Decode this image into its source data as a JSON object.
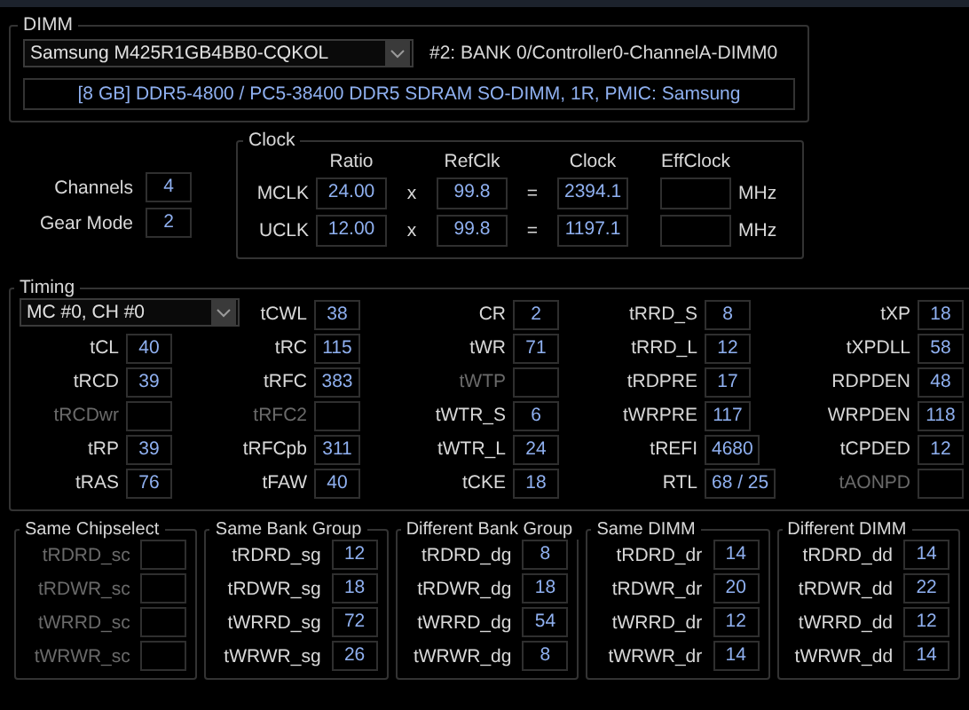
{
  "dimm": {
    "title": "DIMM",
    "module": "Samsung M425R1GB4BB0-CQKOL",
    "slot": "#2: BANK 0/Controller0-ChannelA-DIMM0",
    "description": "[8 GB] DDR5-4800 / PC5-38400 DDR5 SDRAM SO-DIMM, 1R, PMIC: Samsung"
  },
  "memory": [
    {
      "label": "Channels",
      "value": "4"
    },
    {
      "label": "Gear Mode",
      "value": "2"
    }
  ],
  "clock": {
    "title": "Clock",
    "columns": [
      "Ratio",
      "RefClk",
      "Clock",
      "EffClock"
    ],
    "rows": [
      {
        "name": "MCLK",
        "ratio": "24.00",
        "times": "x",
        "refclk": "99.8",
        "equals": "=",
        "clock": "2394.1",
        "unit": "MHz"
      },
      {
        "name": "UCLK",
        "ratio": "12.00",
        "times": "x",
        "refclk": "99.8",
        "equals": "=",
        "clock": "1197.1",
        "unit": "MHz"
      }
    ]
  },
  "timing": {
    "title": "Timing",
    "controller": "MC #0, CH #0",
    "columns": [
      {
        "rows": [
          {
            "label": "tCL",
            "value": "40",
            "disabled": false
          },
          {
            "label": "tRCD",
            "value": "39",
            "disabled": false
          },
          {
            "label": "tRCDwr",
            "disabled": true
          },
          {
            "label": "tRP",
            "value": "39",
            "disabled": false
          },
          {
            "label": "tRAS",
            "value": "76",
            "disabled": false
          }
        ]
      },
      {
        "rows": [
          {
            "label": "tCWL",
            "value": "38",
            "disabled": false
          },
          {
            "label": "tRC",
            "value": "115",
            "disabled": false
          },
          {
            "label": "tRFC",
            "value": "383",
            "disabled": false
          },
          {
            "label": "tRFC2",
            "disabled": true
          },
          {
            "label": "tRFCpb",
            "value": "311",
            "disabled": false
          },
          {
            "label": "tFAW",
            "value": "40",
            "disabled": false
          }
        ]
      },
      {
        "rows": [
          {
            "label": "CR",
            "value": "2",
            "disabled": false
          },
          {
            "label": "tWR",
            "value": "71",
            "disabled": false
          },
          {
            "label": "tWTP",
            "disabled": true
          },
          {
            "label": "tWTR_S",
            "value": "6",
            "disabled": false
          },
          {
            "label": "tWTR_L",
            "value": "24",
            "disabled": false
          },
          {
            "label": "tCKE",
            "value": "18",
            "disabled": false
          }
        ]
      },
      {
        "rows": [
          {
            "label": "tRRD_S",
            "value": "8",
            "disabled": false
          },
          {
            "label": "tRRD_L",
            "value": "12",
            "disabled": false
          },
          {
            "label": "tRDPRE",
            "value": "17",
            "disabled": false
          },
          {
            "label": "tWRPRE",
            "value": "117",
            "disabled": false
          },
          {
            "label": "tREFI",
            "value": "4680",
            "disabled": false
          },
          {
            "label": "RTL",
            "value": "68 / 25",
            "disabled": false
          }
        ]
      },
      {
        "rows": [
          {
            "label": "tXP",
            "value": "18",
            "disabled": false
          },
          {
            "label": "tXPDLL",
            "value": "58",
            "disabled": false
          },
          {
            "label": "RDPDEN",
            "value": "48",
            "disabled": false
          },
          {
            "label": "WRPDEN",
            "value": "118",
            "disabled": false
          },
          {
            "label": "tCPDED",
            "value": "12",
            "disabled": false
          },
          {
            "label": "tAONPD",
            "disabled": true
          }
        ]
      }
    ]
  },
  "turnaround": [
    {
      "title": "Same Chipselect",
      "rows": [
        {
          "label": "tRDRD_sc",
          "disabled": true
        },
        {
          "label": "tRDWR_sc",
          "disabled": true
        },
        {
          "label": "tWRRD_sc",
          "disabled": true
        },
        {
          "label": "tWRWR_sc",
          "disabled": true
        }
      ]
    },
    {
      "title": "Same Bank Group",
      "rows": [
        {
          "label": "tRDRD_sg",
          "value": "12",
          "disabled": false
        },
        {
          "label": "tRDWR_sg",
          "value": "18",
          "disabled": false
        },
        {
          "label": "tWRRD_sg",
          "value": "72",
          "disabled": false
        },
        {
          "label": "tWRWR_sg",
          "value": "26",
          "disabled": false
        }
      ]
    },
    {
      "title": "Different Bank Group",
      "rows": [
        {
          "label": "tRDRD_dg",
          "value": "8",
          "disabled": false
        },
        {
          "label": "tRDWR_dg",
          "value": "18",
          "disabled": false
        },
        {
          "label": "tWRRD_dg",
          "value": "54",
          "disabled": false
        },
        {
          "label": "tWRWR_dg",
          "value": "8",
          "disabled": false
        }
      ]
    },
    {
      "title": "Same DIMM",
      "rows": [
        {
          "label": "tRDRD_dr",
          "value": "14",
          "disabled": false
        },
        {
          "label": "tRDWR_dr",
          "value": "20",
          "disabled": false
        },
        {
          "label": "tWRRD_dr",
          "value": "12",
          "disabled": false
        },
        {
          "label": "tWRWR_dr",
          "value": "14",
          "disabled": false
        }
      ]
    },
    {
      "title": "Different DIMM",
      "rows": [
        {
          "label": "tRDRD_dd",
          "value": "14",
          "disabled": false
        },
        {
          "label": "tRDWR_dd",
          "value": "22",
          "disabled": false
        },
        {
          "label": "tWRRD_dd",
          "value": "12",
          "disabled": false
        },
        {
          "label": "tWRWR_dd",
          "value": "14",
          "disabled": false
        }
      ]
    }
  ]
}
